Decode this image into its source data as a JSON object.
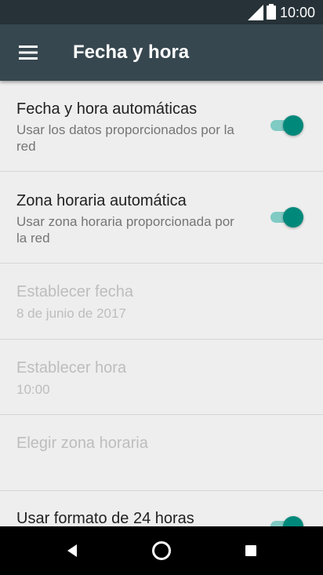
{
  "status_bar": {
    "time": "10:00",
    "signal_icon": "signal-icon",
    "battery_icon": "battery-icon"
  },
  "app_bar": {
    "title": "Fecha y hora",
    "menu_icon": "menu-icon"
  },
  "settings": [
    {
      "title": "Fecha y hora automáticas",
      "subtitle": "Usar los datos proporcionados por la red",
      "toggle": true,
      "enabled": true
    },
    {
      "title": "Zona horaria automática",
      "subtitle": "Usar zona horaria proporcionada por la red",
      "toggle": true,
      "enabled": true
    },
    {
      "title": "Establecer fecha",
      "subtitle": "8 de junio de 2017",
      "enabled": false
    },
    {
      "title": "Establecer hora",
      "subtitle": "10:00",
      "enabled": false
    },
    {
      "title": "Elegir zona horaria",
      "subtitle": "",
      "enabled": false
    },
    {
      "title": "Usar formato de 24 horas",
      "toggle": true,
      "enabled": true
    }
  ],
  "nav_bar": {
    "back": "back-icon",
    "home": "home-icon",
    "recents": "recents-icon"
  },
  "colors": {
    "status_bar": "#263238",
    "app_bar": "#37474f",
    "accent": "#00897b",
    "accent_track": "#80cbc4"
  }
}
